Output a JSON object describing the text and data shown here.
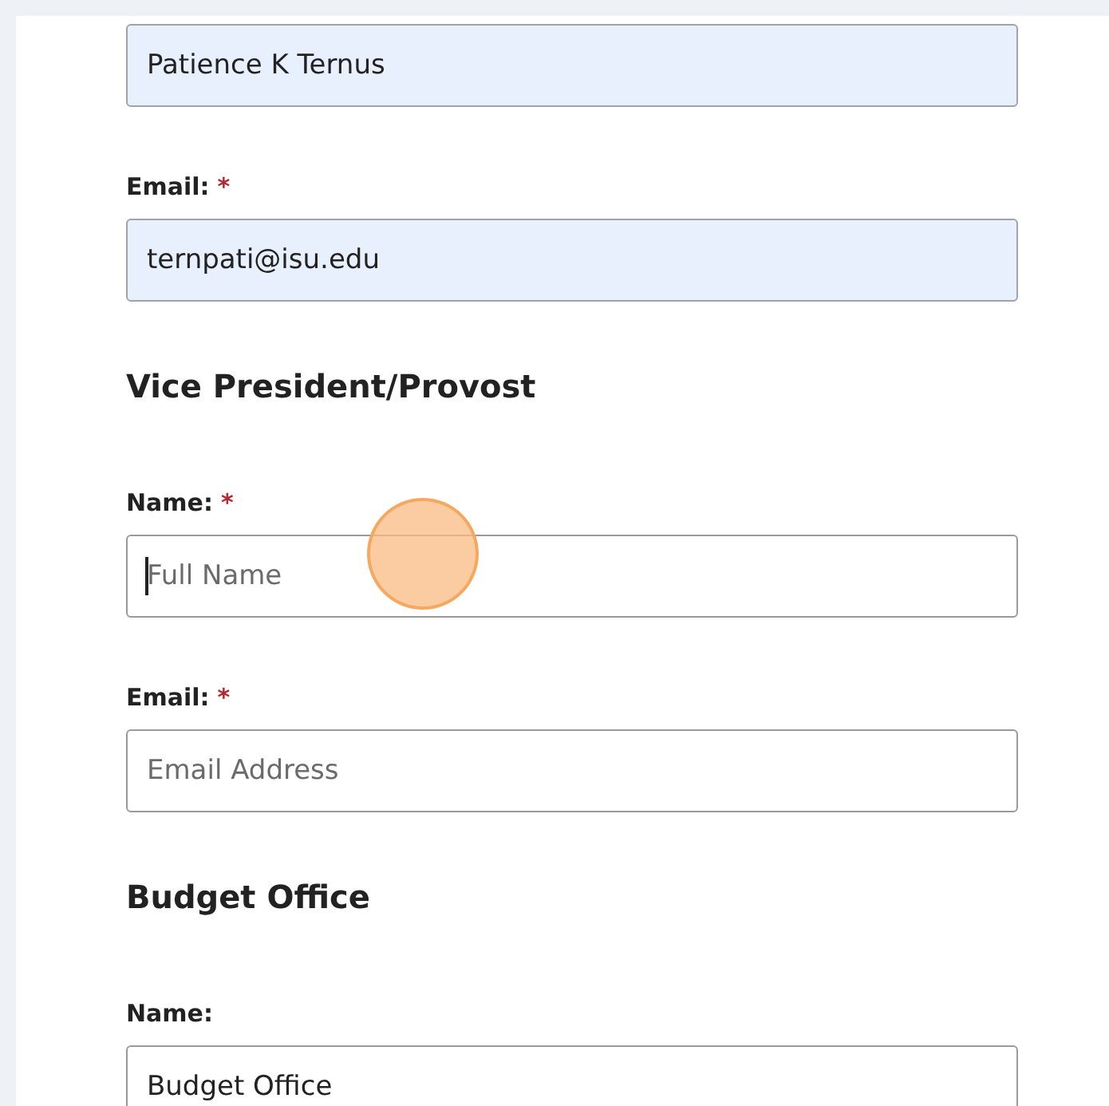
{
  "sections": [
    {
      "fields": [
        {
          "value": "Patience K Ternus",
          "autofilled": true,
          "focused": false,
          "click_marker": false
        },
        {
          "label": "Email:",
          "required_mark": "*",
          "value": "ternpati@isu.edu",
          "autofilled": true,
          "focused": false,
          "click_marker": false
        }
      ]
    },
    {
      "heading": "Vice President/Provost",
      "fields": [
        {
          "label": "Name:",
          "required_mark": "*",
          "placeholder": "Full Name",
          "autofilled": false,
          "focused": true,
          "click_marker": true
        },
        {
          "label": "Email:",
          "required_mark": "*",
          "placeholder": "Email Address",
          "autofilled": false,
          "focused": false,
          "click_marker": false
        }
      ]
    },
    {
      "heading": "Budget Office",
      "fields": [
        {
          "label": "Name:",
          "value": "Budget Office",
          "autofilled": false,
          "focused": false,
          "click_marker": false
        }
      ]
    }
  ]
}
